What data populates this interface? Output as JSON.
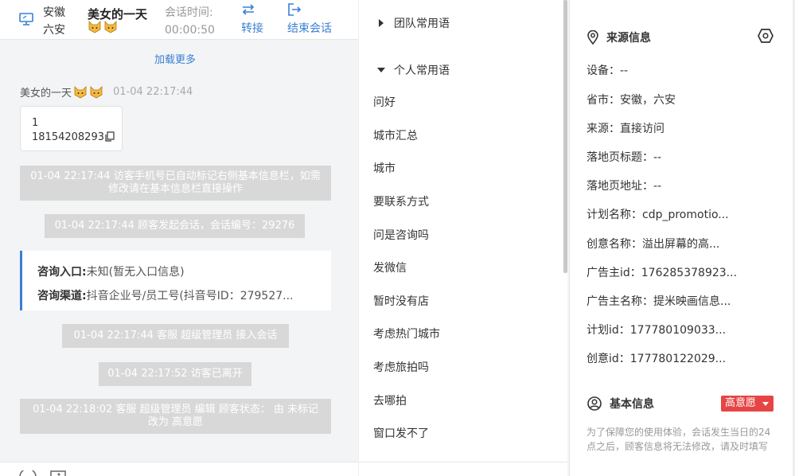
{
  "header": {
    "location_province": "安徽",
    "location_city": "六安",
    "customer_name": "美女的一天",
    "session_time_label": "会话时间:",
    "session_time_value": "00:00:50",
    "transfer_label": "转接",
    "end_label": "结束会话"
  },
  "chat": {
    "load_more": "加载更多",
    "message": {
      "sender": "美女的一天",
      "timestamp": "01-04 22:17:44",
      "line1": "1",
      "line2": "18154208293"
    },
    "system_messages": [
      "01-04 22:17:44 访客手机号已自动标记右侧基本信息栏，如需修改请在基本信息栏直接操作",
      "01-04 22:17:44 顾客发起会话，会话编号：29276",
      "01-04 22:17:44 客服 超级管理员 接入会话",
      "01-04 22:17:52 访客已离开",
      "01-04 22:18:02 客服 超级管理员 编辑 顾客状态： 由 未标记 改为 高意愿"
    ],
    "info_card": {
      "entry_key": "咨询入口:",
      "entry_value": "未知(暂无入口信息)",
      "channel_key": "咨询渠道:",
      "channel_value": "抖音企业号/员工号(抖音号ID：279527..."
    }
  },
  "phrases": {
    "team_group": "团队常用语",
    "personal_group": "个人常用语",
    "items": [
      "问好",
      "城市汇总",
      "城市",
      "要联系方式",
      "问是咨询吗",
      "发微信",
      "暂时没有店",
      "考虑热门城市",
      "考虑旅拍吗",
      "去哪拍",
      "窗口发不了"
    ]
  },
  "source_info": {
    "title": "来源信息",
    "fields": [
      "设备：--",
      "省市：安徽，六安",
      "来源：直接访问",
      "落地页标题：--",
      "落地页地址：--",
      "计划名称：cdp_promotio...",
      "创意名称：溢出屏幕的高...",
      "广告主id：176285378923...",
      "广告主名称：提米映画信息...",
      "计划id：177780109033...",
      "创意id：177780122029..."
    ]
  },
  "basic_info": {
    "title": "基本信息",
    "intent_badge": "高意愿",
    "notice": "为了保障您的使用体验，会话发生当日的24点之后，顾客信息将无法修改，请及时填写"
  },
  "colors": {
    "accent": "#3a7fd5",
    "system_bubble": "#d8d8d8",
    "badge": "#e64545"
  }
}
